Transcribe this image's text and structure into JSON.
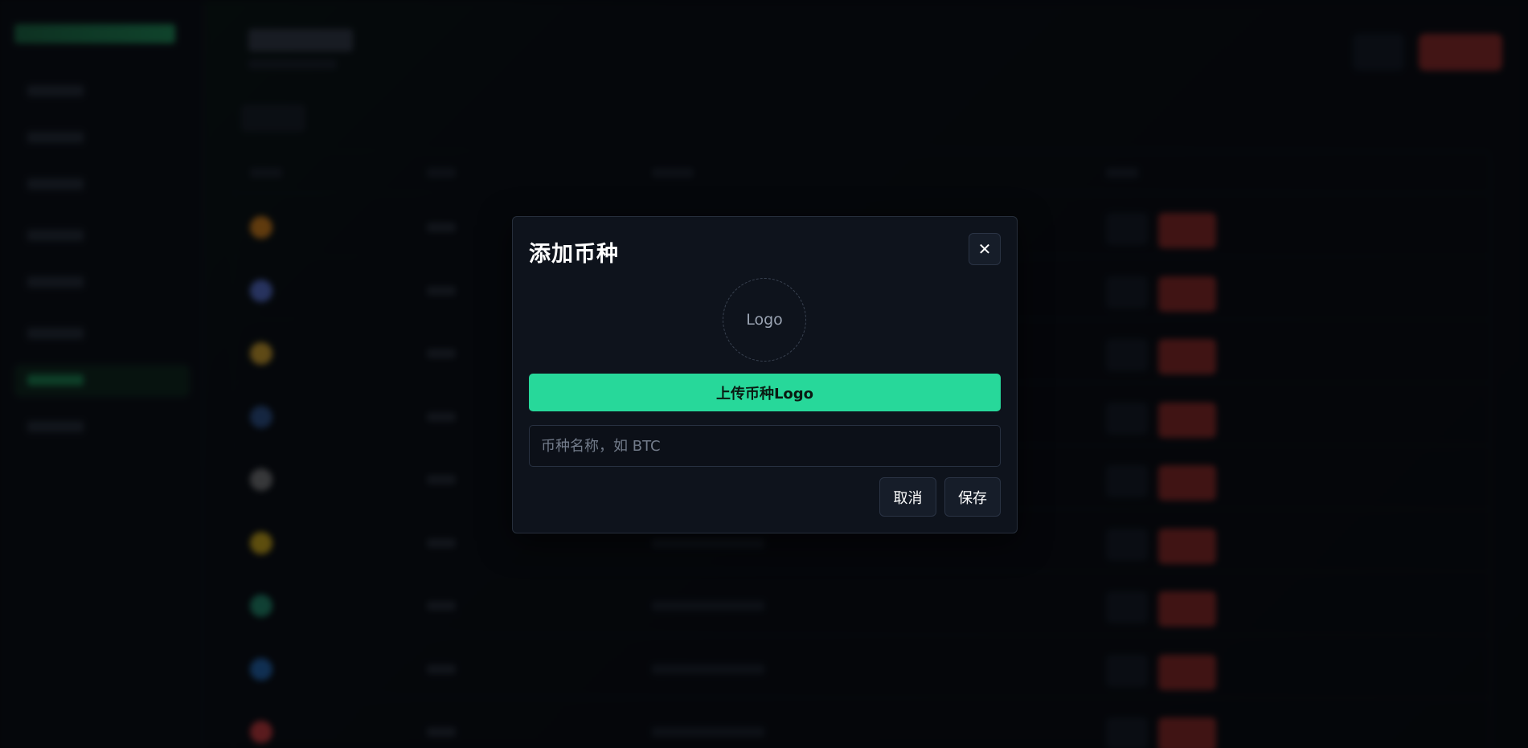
{
  "modal": {
    "title": "添加币种",
    "close_glyph": "✕",
    "logo_placeholder": "Logo",
    "upload_label": "上传币种Logo",
    "coin_name_placeholder": "币种名称，如 BTC",
    "coin_name_value": "",
    "cancel_label": "取消",
    "save_label": "保存"
  },
  "background": {
    "coin_colors": [
      "#f7931a",
      "#627eea",
      "#f3ba2f",
      "#345d9d",
      "#8c8c8c",
      "#f0c419",
      "#26a17b",
      "#2775ca",
      "#e84142"
    ]
  },
  "colors": {
    "accent": "#27d89a",
    "danger": "#a8302b",
    "modal_bg": "#0e131c"
  },
  "icons": {
    "close": "close-icon"
  }
}
